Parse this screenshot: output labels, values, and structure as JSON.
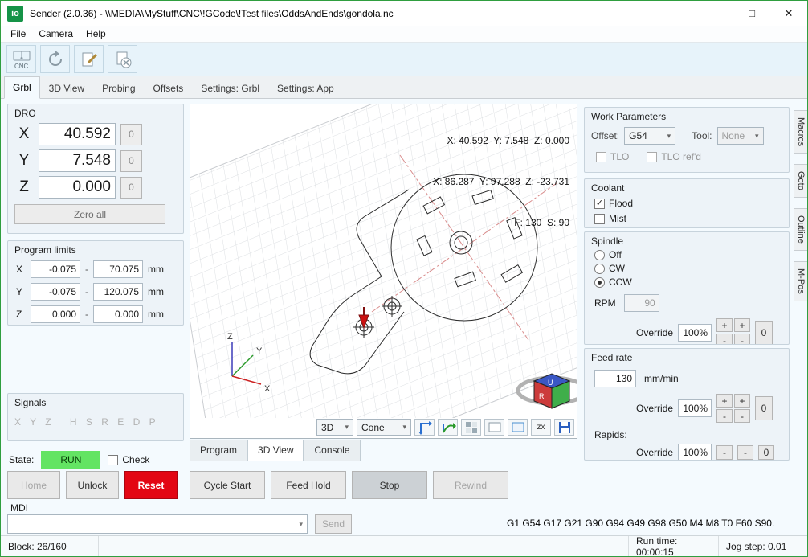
{
  "window": {
    "icon_text": "io",
    "title": "Sender (2.0.36) - \\\\MEDIA\\MyStuff\\CNC\\!GCode\\!Test files\\OddsAndEnds\\gondola.nc",
    "minimize": "–",
    "maximize": "□",
    "close": "✕"
  },
  "icons": {
    "chevron_down": "▾",
    "check": "✓"
  },
  "menu": {
    "items": [
      "File",
      "Camera",
      "Help"
    ]
  },
  "toolbar": {
    "cnc_label": "CNC"
  },
  "main_tabs": {
    "items": [
      "Grbl",
      "3D View",
      "Probing",
      "Offsets",
      "Settings: Grbl",
      "Settings: App"
    ],
    "active": "Grbl"
  },
  "side_tabs": {
    "items": [
      "Macros",
      "Goto",
      "Outline",
      "M-Pos"
    ]
  },
  "dro": {
    "title": "DRO",
    "zero_button": "0",
    "zero_all": "Zero all",
    "axes": [
      {
        "label": "X",
        "value": "40.592"
      },
      {
        "label": "Y",
        "value": "7.548"
      },
      {
        "label": "Z",
        "value": "0.000"
      }
    ]
  },
  "program_limits": {
    "title": "Program limits",
    "separator": "-",
    "rows": [
      {
        "axis": "X",
        "min": "-0.075",
        "max": "70.075",
        "unit": "mm"
      },
      {
        "axis": "Y",
        "min": "-0.075",
        "max": "120.075",
        "unit": "mm"
      },
      {
        "axis": "Z",
        "min": "0.000",
        "max": "0.000",
        "unit": "mm"
      }
    ]
  },
  "signals": {
    "title": "Signals",
    "group1": "X Y Z",
    "group2": "H S R E D P"
  },
  "state": {
    "label": "State:",
    "value": "RUN",
    "check_label": "Check"
  },
  "control_buttons": {
    "home": "Home",
    "unlock": "Unlock",
    "reset": "Reset"
  },
  "viewport": {
    "overlay": {
      "wpos": "X: 40.592  Y: 7.548  Z: 0.000",
      "mpos": "X: 86.287  Y: 97.288  Z: -23.731",
      "feed_speed": "F: 130  S: 90"
    },
    "view_select": "3D",
    "tool_select": "Cone",
    "plane_label": "zx",
    "axes": {
      "x": "X",
      "y": "Y",
      "z": "Z"
    },
    "cube": {
      "top": "U",
      "front": "R"
    },
    "tabs": [
      "Program",
      "3D View",
      "Console"
    ],
    "active_tab": "3D View"
  },
  "transport": {
    "cycle_start": "Cycle Start",
    "feed_hold": "Feed Hold",
    "stop": "Stop",
    "rewind": "Rewind"
  },
  "work_parameters": {
    "title": "Work Parameters",
    "offset_label": "Offset:",
    "offset_value": "G54",
    "tool_label": "Tool:",
    "tool_value": "None",
    "tlo_label": "TLO",
    "tlo_refd_label": "TLO ref'd"
  },
  "coolant": {
    "title": "Coolant",
    "flood": "Flood",
    "mist": "Mist"
  },
  "spindle": {
    "title": "Spindle",
    "options": [
      "Off",
      "CW",
      "CCW"
    ],
    "selected": "CCW",
    "rpm_label": "RPM",
    "rpm_value": "90",
    "override": {
      "label": "Override",
      "value": "100%"
    }
  },
  "feed_rate": {
    "title": "Feed rate",
    "value": "130",
    "unit": "mm/min",
    "override": {
      "label": "Override",
      "value": "100%"
    },
    "rapids_label": "Rapids:",
    "rapids_override": {
      "label": "Override",
      "value": "100%"
    }
  },
  "ovr_buttons": {
    "plus": "+",
    "minus": "-",
    "zero": "0"
  },
  "mdi": {
    "label": "MDI",
    "input_value": "",
    "send": "Send",
    "parser_state": "G1 G54 G17 G21 G90 G94 G49 G98 G50 M4 M8 T0 F60 S90."
  },
  "status_bar": {
    "block": "Block: 26/160",
    "run_time": "Run time: 00:00:15",
    "jog_step": "Jog step: 0.01"
  }
}
